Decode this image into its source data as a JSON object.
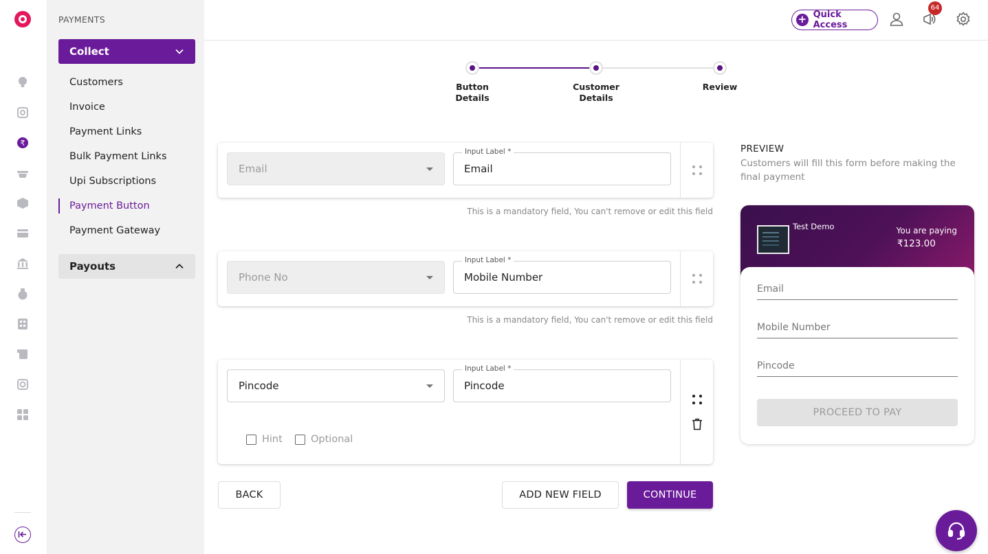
{
  "sidebar": {
    "heading": "PAYMENTS",
    "collect": {
      "label": "Collect",
      "items": [
        {
          "label": "Customers"
        },
        {
          "label": "Invoice"
        },
        {
          "label": "Payment Links"
        },
        {
          "label": "Bulk Payment Links"
        },
        {
          "label": "Upi Subscriptions"
        },
        {
          "label": "Payment Button",
          "selected": true
        },
        {
          "label": "Payment Gateway"
        }
      ]
    },
    "payouts": {
      "label": "Payouts"
    }
  },
  "rail_icons": [
    "bulb-icon",
    "analytics-icon",
    "rupee-circle-icon",
    "basket-icon",
    "box-icon",
    "card-icon",
    "bank-icon",
    "money-bag-icon",
    "calculator-icon",
    "receipt-icon",
    "settlement-icon",
    "grid-icon"
  ],
  "topbar": {
    "quick_access": "Quick Access",
    "notifications_count": "64"
  },
  "stepper": {
    "steps": [
      {
        "label": "Button\nDetails"
      },
      {
        "label": "Customer\nDetails"
      },
      {
        "label": "Review"
      }
    ]
  },
  "fields": [
    {
      "type": "Email",
      "input_label": "Input Label *",
      "value": "Email",
      "note": "This is a mandatory field, You can't remove or edit this field"
    },
    {
      "type": "Phone No",
      "input_label": "Input Label *",
      "value": "Mobile Number",
      "note": "This is a mandatory field, You can't remove or edit this field"
    },
    {
      "type": "Pincode",
      "input_label": "Input Label *",
      "value": "Pincode",
      "hint_label": "Hint",
      "optional_label": "Optional"
    }
  ],
  "actions": {
    "back": "BACK",
    "add_new_field": "ADD NEW FIELD",
    "continue": "CONTINUE"
  },
  "preview": {
    "title": "PREVIEW",
    "subtitle": "Customers will fill this form before making the final payment",
    "merchant": "Test Demo",
    "paying_label": "You are paying",
    "amount": "₹123.00",
    "fields": [
      "Email",
      "Mobile Number",
      "Pincode"
    ],
    "pay_button": "PROCEED TO PAY"
  },
  "colors": {
    "brand": "#6a1b9a",
    "logo": "#e5175c",
    "badge": "#c62828"
  }
}
